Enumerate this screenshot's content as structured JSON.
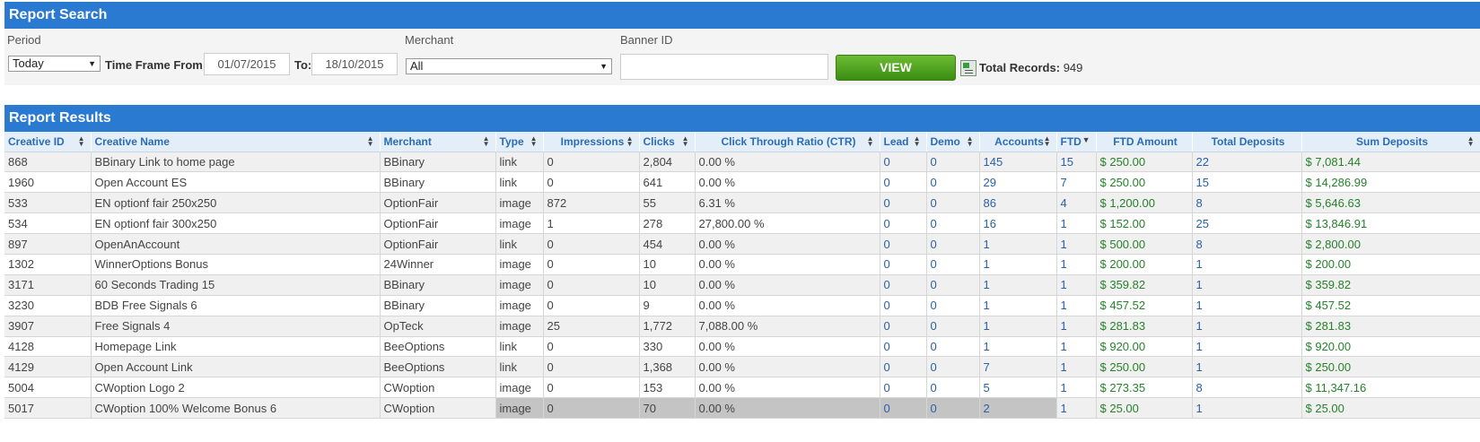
{
  "search": {
    "title": "Report Search",
    "period_label": "Period",
    "period_value": "Today",
    "timeframe_label": "Time Frame From:",
    "from_value": "01/07/2015",
    "to_label": "To:",
    "to_value": "18/10/2015",
    "merchant_label": "Merchant",
    "merchant_value": "All",
    "banner_label": "Banner ID",
    "banner_value": "",
    "view_label": "VIEW",
    "total_label": "Total Records:",
    "total_value": "949"
  },
  "results": {
    "title": "Report Results",
    "headers": [
      "Creative ID",
      "Creative Name",
      "Merchant",
      "Type",
      "Impressions",
      "Clicks",
      "Click Through Ratio (CTR)",
      "Lead",
      "Demo",
      "Accounts",
      "FTD",
      "FTD Amount",
      "Total Deposits",
      "Sum Deposits"
    ],
    "rows": [
      [
        "868",
        "BBinary Link to home page",
        "BBinary",
        "link",
        "0",
        "2,804",
        "0.00 %",
        "0",
        "0",
        "145",
        "15",
        "$ 250.00",
        "22",
        "$ 7,081.44"
      ],
      [
        "1960",
        "Open Account ES",
        "BBinary",
        "link",
        "0",
        "641",
        "0.00 %",
        "0",
        "0",
        "29",
        "7",
        "$ 250.00",
        "15",
        "$ 14,286.99"
      ],
      [
        "533",
        "EN optionf fair 250x250",
        "OptionFair",
        "image",
        "872",
        "55",
        "6.31 %",
        "0",
        "0",
        "86",
        "4",
        "$ 1,200.00",
        "8",
        "$ 5,646.63"
      ],
      [
        "534",
        "EN optionf fair 300x250",
        "OptionFair",
        "image",
        "1",
        "278",
        "27,800.00 %",
        "0",
        "0",
        "16",
        "1",
        "$ 152.00",
        "25",
        "$ 13,846.91"
      ],
      [
        "897",
        "OpenAnAccount",
        "OptionFair",
        "link",
        "0",
        "454",
        "0.00 %",
        "0",
        "0",
        "1",
        "1",
        "$ 500.00",
        "8",
        "$ 2,800.00"
      ],
      [
        "1302",
        "WinnerOptions Bonus",
        "24Winner",
        "image",
        "0",
        "10",
        "0.00 %",
        "0",
        "0",
        "1",
        "1",
        "$ 200.00",
        "1",
        "$ 200.00"
      ],
      [
        "3171",
        "60 Seconds Trading 15",
        "BBinary",
        "image",
        "0",
        "10",
        "0.00 %",
        "0",
        "0",
        "1",
        "1",
        "$ 359.82",
        "1",
        "$ 359.82"
      ],
      [
        "3230",
        "BDB Free Signals 6",
        "BBinary",
        "image",
        "0",
        "9",
        "0.00 %",
        "0",
        "0",
        "1",
        "1",
        "$ 457.52",
        "1",
        "$ 457.52"
      ],
      [
        "3907",
        "Free Signals 4",
        "OpTeck",
        "image",
        "25",
        "1,772",
        "7,088.00 %",
        "0",
        "0",
        "1",
        "1",
        "$ 281.83",
        "1",
        "$ 281.83"
      ],
      [
        "4128",
        "Homepage Link",
        "BeeOptions",
        "link",
        "0",
        "330",
        "0.00 %",
        "0",
        "0",
        "1",
        "1",
        "$ 920.00",
        "1",
        "$ 920.00"
      ],
      [
        "4129",
        "Open Account Link",
        "BeeOptions",
        "link",
        "0",
        "1,368",
        "0.00 %",
        "0",
        "0",
        "7",
        "1",
        "$ 250.00",
        "1",
        "$ 250.00"
      ],
      [
        "5004",
        "CWoption Logo 2",
        "CWoption",
        "image",
        "0",
        "153",
        "0.00 %",
        "0",
        "0",
        "5",
        "1",
        "$ 273.35",
        "8",
        "$ 11,347.16"
      ],
      [
        "5017",
        "CWoption 100% Welcome Bonus 6",
        "CWoption",
        "image",
        "0",
        "70",
        "0.00 %",
        "0",
        "0",
        "2",
        "1",
        "$ 25.00",
        "1",
        "$ 25.00"
      ]
    ]
  }
}
